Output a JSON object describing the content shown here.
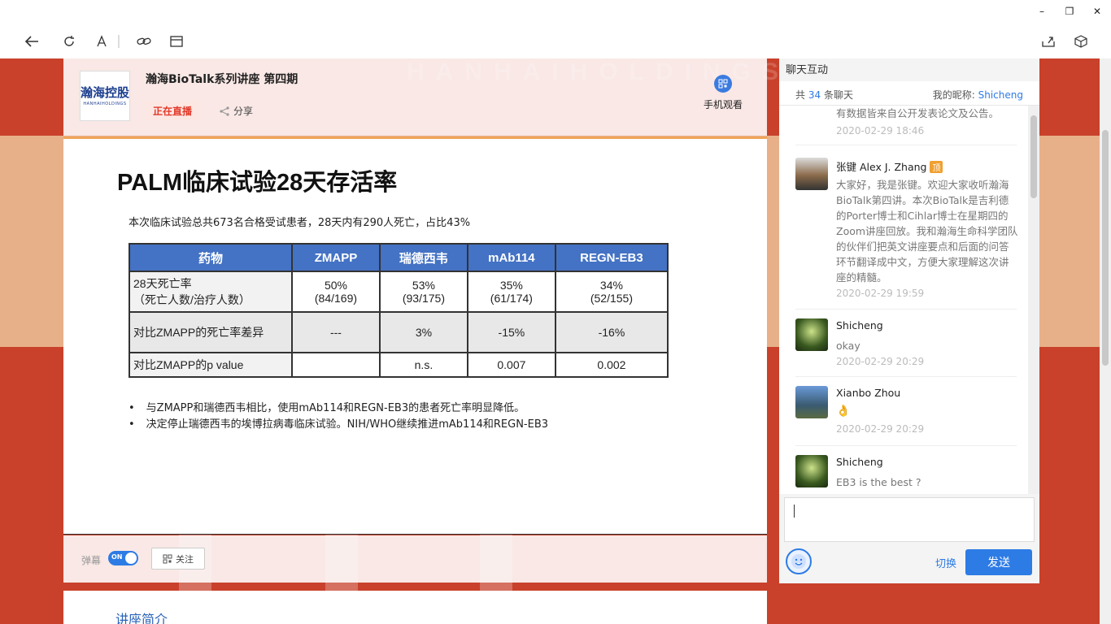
{
  "window": {
    "minimize": "–",
    "restore": "❐",
    "close": "✕"
  },
  "slide": {
    "title": "PALM临床试验28天存活率",
    "subtitle": "本次临床试验总共673名合格受试患者，28天内有290人死亡，占比43%",
    "table": {
      "headers": [
        "药物",
        "ZMAPP",
        "瑞德西韦",
        "mAb114",
        "REGN-EB3"
      ],
      "rows": [
        {
          "label": "28天死亡率\n（死亡人数/治疗人数）",
          "cells": [
            "50%\n(84/169)",
            "53%\n(93/175)",
            "35%\n(61/174)",
            "34%\n(52/155)"
          ]
        },
        {
          "label": "对比ZMAPP的死亡率差异",
          "cells": [
            "---",
            "3%",
            "-15%",
            "-16%"
          ]
        },
        {
          "label": "对比ZMAPP的p value",
          "cells": [
            "",
            "n.s.",
            "0.007",
            "0.002"
          ]
        }
      ]
    },
    "bullets": [
      "与ZMAPP和瑞德西韦相比，使用mAb114和REGN-EB3的患者死亡率明显降低。",
      "决定停止瑞德西韦的埃博拉病毒临床试验。NIH/WHO继续推进mAb114和REGN-EB3"
    ]
  },
  "header": {
    "logo_text": "瀚海控股",
    "logo_sub": "HANHAIHOLDINGS",
    "title": "瀚海BioTalk系列讲座 第四期",
    "live": "正在直播",
    "share": "分享",
    "mobile": "手机观看"
  },
  "controls": {
    "danmu": "弹幕",
    "toggle": "ON",
    "follow": "关注"
  },
  "intro": {
    "title": "讲座简介"
  },
  "chat": {
    "title": "聊天互动",
    "count_prefix": "共",
    "count": "34",
    "count_suffix": "条聊天",
    "nick_label": "我的昵称:",
    "nick": "Shicheng",
    "messages": [
      {
        "text": "有数据皆来自公开发表论文及公告。",
        "time": "2020-02-29 18:46"
      },
      {
        "name": "张键 Alex J. Zhang",
        "tag": "顶",
        "text": "大家好，我是张键。欢迎大家收听瀚海BioTalk第四讲。本次BioTalk是吉利德的Porter博士和Cihlar博士在星期四的Zoom讲座回放。我和瀚海生命科学团队的伙伴们把英文讲座要点和后面的问答环节翻译成中文，方便大家理解这次讲座的精髓。",
        "time": "2020-02-29 19:59"
      },
      {
        "name": "Shicheng",
        "text": "okay",
        "time": "2020-02-29 20:29"
      },
      {
        "name": "Xianbo Zhou",
        "text": "👌",
        "time": "2020-02-29 20:29"
      },
      {
        "name": "Shicheng",
        "text": "EB3 is the best ?",
        "time": ""
      }
    ],
    "switch": "切换",
    "send": "发送"
  },
  "colors": {
    "accent": "#2d7be5",
    "stage_bg": "#c9412b",
    "table_header": "#4472c4",
    "live": "#e23a2a"
  }
}
